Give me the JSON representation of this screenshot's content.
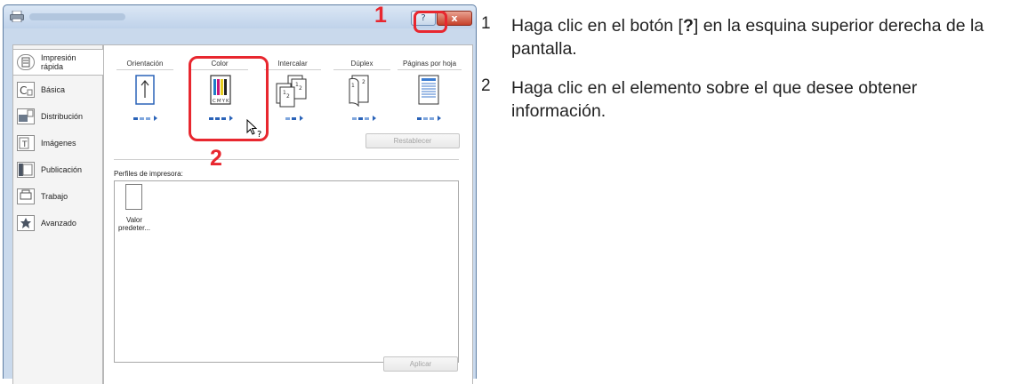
{
  "window": {
    "help_glyph": "?",
    "close_glyph": "x"
  },
  "sidebar": {
    "items": [
      {
        "label": "Impresión rápida",
        "icon": "quick-print-icon"
      },
      {
        "label": "Básica",
        "icon": "basic-icon"
      },
      {
        "label": "Distribución",
        "icon": "layout-icon"
      },
      {
        "label": "Imágenes",
        "icon": "images-icon"
      },
      {
        "label": "Publicación",
        "icon": "publishing-icon"
      },
      {
        "label": "Trabajo",
        "icon": "job-icon"
      },
      {
        "label": "Avanzado",
        "icon": "advanced-icon"
      }
    ]
  },
  "options": {
    "orientation": "Orientación",
    "color": "Color",
    "collate": "Intercalar",
    "duplex": "Dúplex",
    "pages_per_sheet": "Páginas por hoja"
  },
  "color_icon_letters": "CMYK",
  "buttons": {
    "reset": "Restablecer",
    "apply": "Aplicar"
  },
  "profiles": {
    "label": "Perfiles de impresora:",
    "items": [
      {
        "name": "Valor predeter..."
      }
    ]
  },
  "callouts": {
    "one": "1",
    "two": "2"
  },
  "instructions": {
    "step1": {
      "number": "1",
      "before": "Haga clic en el botón [",
      "bold": "?",
      "after": "] en la esquina superior derecha de la pantalla."
    },
    "step2": {
      "number": "2",
      "text": "Haga clic en el elemento sobre el que desee obtener información."
    }
  },
  "colors": {
    "highlight": "#e8272f",
    "accent_blue": "#2a63b8"
  }
}
